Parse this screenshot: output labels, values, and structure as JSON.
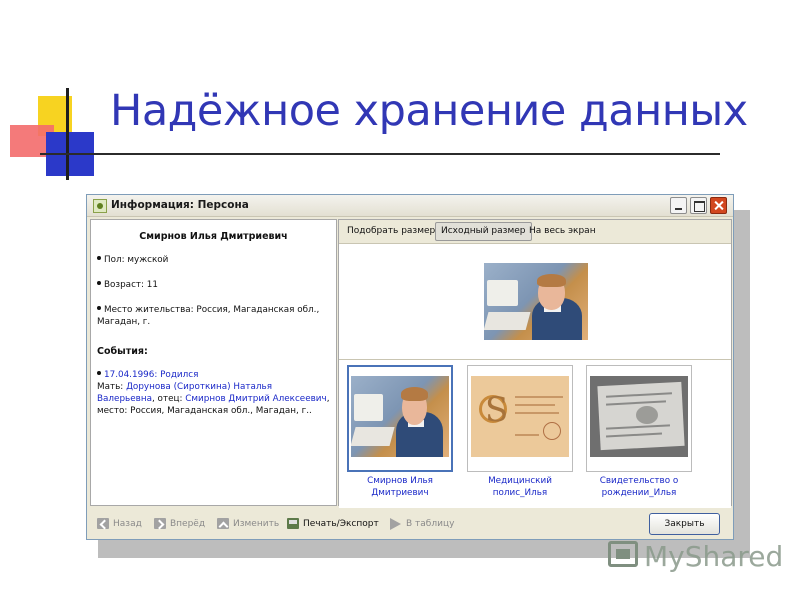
{
  "slide": {
    "title": "Надёжное хранение данных",
    "colors": {
      "title": "#3137b5",
      "accent_yellow": "#f7d321",
      "accent_red": "#f36b6b",
      "accent_blue": "#2b39c9"
    }
  },
  "window": {
    "title": "Информация: Персона",
    "buttons": [
      "minimize-icon",
      "maximize-icon",
      "close-icon"
    ]
  },
  "info": {
    "name": "Смирнов Илья Дмитриевич",
    "gender": "Пол: мужской",
    "age": "Возраст: 11",
    "residence": "Место жительства: Россия, Магаданская обл., Магадан, г.",
    "events_title": "События:",
    "event_date": "17.04.1996: Родился",
    "mother_prefix": "Мать: ",
    "mother_name": "Дорунова (Сироткина) Наталья Валерьевна",
    "father_prefix": ", отец: ",
    "father_name": "Смирнов Дмитрий Алексеевич",
    "place": ", место: Россия, Магаданская обл., Магадан, г.."
  },
  "view": {
    "fit": "Подобрать размер",
    "original": "Исходный размер",
    "fullscreen": "На весь экран"
  },
  "thumbnails": [
    {
      "label": "Смирнов Илья Дмитриевич",
      "selected": true
    },
    {
      "label": "Медицинский полис_Илья",
      "selected": false
    },
    {
      "label": "Свидетельство о рождении_Илья",
      "selected": false
    }
  ],
  "toolbar": {
    "back": "Назад",
    "forward": "Вперёд",
    "edit": "Изменить",
    "print": "Печать/Экспорт",
    "table": "В таблицу",
    "close": "Закрыть"
  },
  "watermark": {
    "text": "MyShared"
  }
}
